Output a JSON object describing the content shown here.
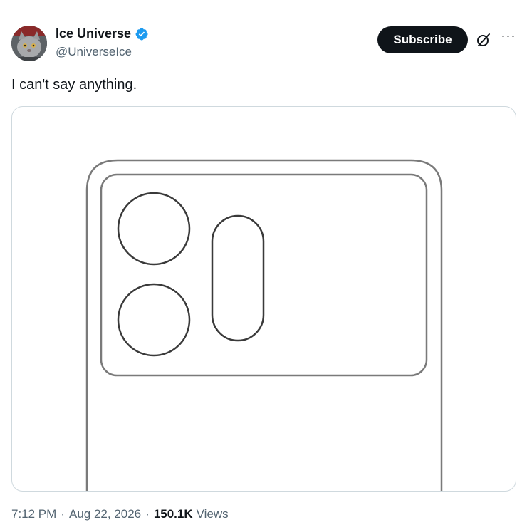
{
  "author": {
    "display_name": "Ice Universe",
    "handle": "@UniverseIce",
    "verified": true,
    "avatar": "gray-cat-avatar"
  },
  "actions": {
    "subscribe_label": "Subscribe",
    "grok_icon": "grok-slash-icon",
    "more_icon": "more-dots-icon",
    "more_glyph": "···"
  },
  "tweet": {
    "text": "I can't say anything."
  },
  "media": {
    "description_icon": "phone-back-camera-sketch"
  },
  "meta": {
    "time": "7:12 PM",
    "separator": "·",
    "date": "Aug 22, 2026",
    "views_count": "150.1K",
    "views_label": "Views"
  },
  "colors": {
    "text_primary": "#0f1419",
    "text_secondary": "#536471",
    "verified_blue": "#1d9bf0",
    "button_bg": "#0f1419",
    "border": "#cfd9de"
  }
}
